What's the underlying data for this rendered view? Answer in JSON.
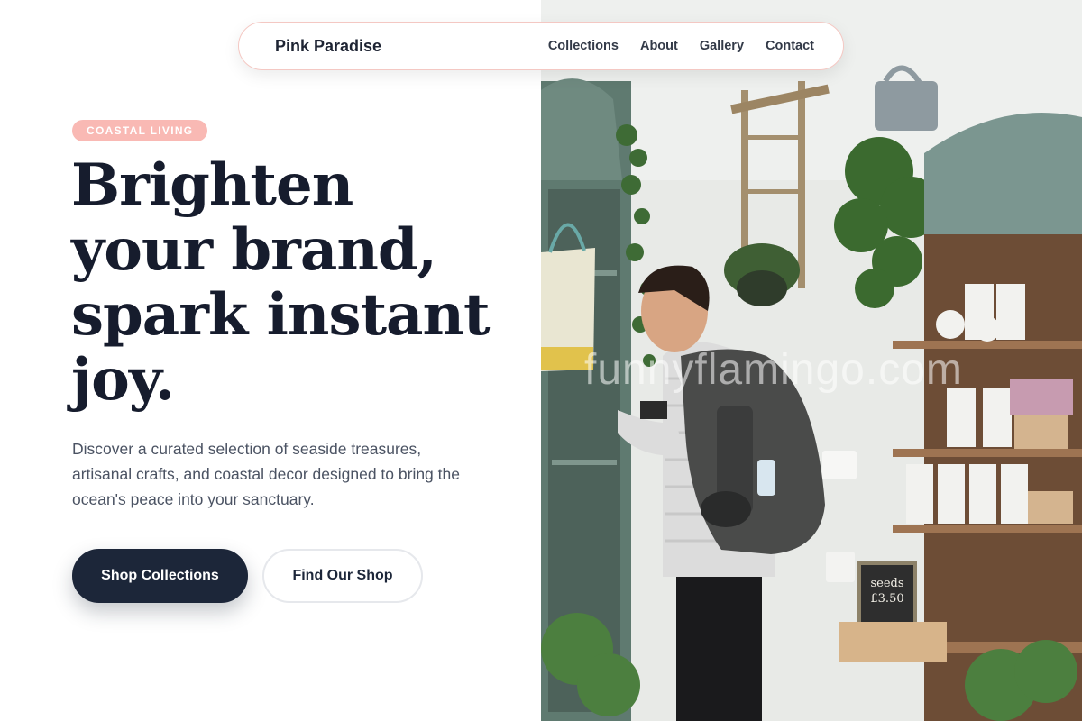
{
  "nav": {
    "brand": "Pink Paradise",
    "links": [
      "Collections",
      "About",
      "Gallery",
      "Contact"
    ]
  },
  "hero": {
    "tag": "Coastal Living",
    "headline_lines": [
      "Brighten",
      "your brand,",
      "spark instant",
      "joy."
    ],
    "description": "Discover a curated selection of seaside treasures, artisanal crafts, and coastal decor designed to bring the ocean's peace into your sanctuary.",
    "primary_cta": "Shop Collections",
    "secondary_cta": "Find Our Shop"
  },
  "photo": {
    "watermark": "funnyflamingo.com",
    "chalkboard_text": [
      "seeds",
      "£3.50"
    ]
  },
  "colors": {
    "accent_pink": "#f9b9b4",
    "navy": "#1c2639",
    "heading": "#161c2d",
    "body_text": "#4b5363"
  }
}
